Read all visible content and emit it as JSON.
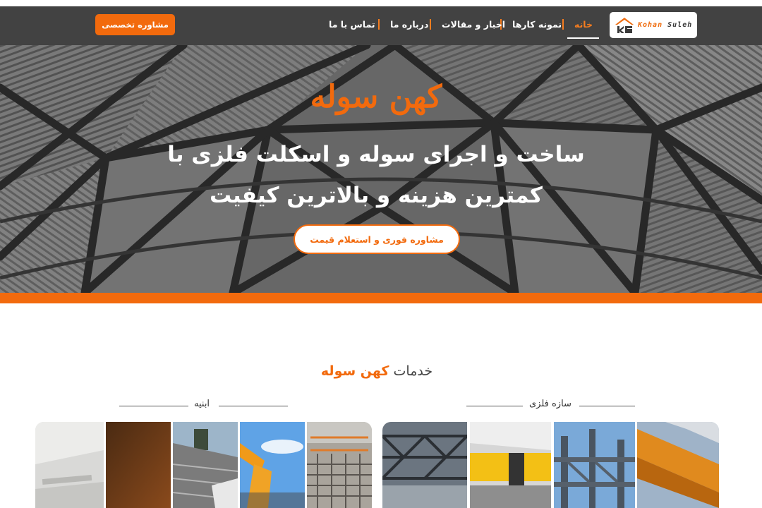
{
  "header": {
    "logo": {
      "word1": "Kohan",
      "word2": "Suleh"
    },
    "nav": [
      {
        "label": "خانه",
        "active": true
      },
      {
        "label": "نمونه کارها",
        "active": false
      },
      {
        "label": "اخبار و مقالات",
        "active": false
      },
      {
        "label": "درباره ما",
        "active": false
      },
      {
        "label": "تماس با ما",
        "active": false
      }
    ],
    "consult_label": "مشاوره تخصصی"
  },
  "hero": {
    "title": "کهن سوله",
    "subtitle_line1": "ساخت و اجرای سوله و اسکلت فلزی با",
    "subtitle_line2": "کمترین هزینه و بالاترین کیفیت",
    "cta_label": "مشاوره فوری و استعلام قیمت"
  },
  "services": {
    "title_prefix": "خدمات",
    "title_accent": "کهن سوله",
    "categories": [
      {
        "label": "سازه فلزی"
      },
      {
        "label": "ابنیه"
      }
    ]
  },
  "colors": {
    "accent": "#f26a0d",
    "header_bg": "#424242"
  }
}
